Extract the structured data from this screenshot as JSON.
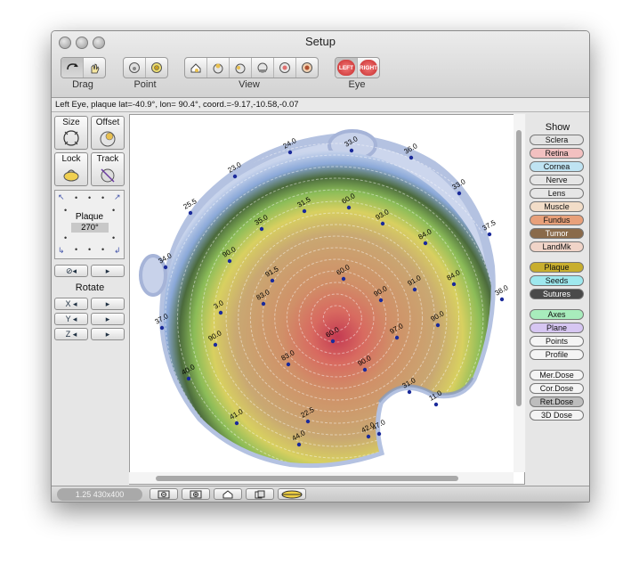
{
  "window": {
    "title": "Setup"
  },
  "toolbar": {
    "groups": [
      {
        "label": "Drag"
      },
      {
        "label": "Point"
      },
      {
        "label": "View"
      },
      {
        "label": "Eye"
      }
    ],
    "eye_left": "LEFT",
    "eye_right": "RIGHT"
  },
  "status_line": "Left Eye, plaque lat=-40.9°, lon= 90.4°, coord.=-9.17,-10.58,-0.07",
  "left_panel": {
    "size_label": "Size",
    "offset_label": "Offset",
    "lock_label": "Lock",
    "track_label": "Track",
    "plaque_label": "Plaque",
    "plaque_angle": "270°",
    "rotate_label": "Rotate",
    "axes": [
      "X",
      "Y",
      "Z"
    ]
  },
  "show_panel": {
    "title": "Show",
    "items": [
      {
        "label": "Sclera",
        "color": "#e3e3e3"
      },
      {
        "label": "Retina",
        "color": "#f2c0c0"
      },
      {
        "label": "Cornea",
        "color": "#bfe3f2"
      },
      {
        "label": "Nerve",
        "color": "#e6e6e6"
      },
      {
        "label": "Lens",
        "color": "#e6e6e6"
      },
      {
        "label": "Muscle",
        "color": "#f2ddc8"
      },
      {
        "label": "Fundus",
        "color": "#e8a07a"
      },
      {
        "label": "Tumor",
        "color": "#8a6a4a"
      },
      {
        "label": "LandMk",
        "color": "#f0d4c8"
      },
      {
        "label": "Plaque",
        "color": "#c8ae2e"
      },
      {
        "label": "Seeds",
        "color": "#9ee8ee"
      },
      {
        "label": "Sutures",
        "color": "#4a4a4a"
      },
      {
        "label": "Axes",
        "color": "#a8ecbc"
      },
      {
        "label": "Plane",
        "color": "#d6c6f2"
      },
      {
        "label": "Points",
        "color": "#f4f4f4"
      },
      {
        "label": "Profile",
        "color": "#f4f4f4"
      },
      {
        "label": "Mer.Dose",
        "color": "#f4f4f4"
      },
      {
        "label": "Cor.Dose",
        "color": "#f4f4f4"
      },
      {
        "label": "Ret.Dose",
        "color": "#bdbdbd"
      },
      {
        "label": "3D Dose",
        "color": "#f4f4f4"
      }
    ]
  },
  "bottom": {
    "zoom_readout": "1.25 430x400"
  },
  "dose_map": {
    "point_labels": [
      "24.0",
      "33.0",
      "36.0",
      "23.0",
      "33.0",
      "25.5",
      "37.5",
      "34.0",
      "38.0",
      "37.0",
      "40.0",
      "41.0",
      "44.0",
      "47.0",
      "42.0",
      "22.5",
      "31.0",
      "11.0",
      "3.0",
      "35.0",
      "31.5",
      "60.0",
      "93.0",
      "84.0",
      "90.0",
      "91.5",
      "60.0",
      "90.0",
      "91.0",
      "84.0",
      "90.0",
      "83.0",
      "60.0",
      "97.0",
      "90.0",
      "83.0",
      "90.0"
    ]
  }
}
